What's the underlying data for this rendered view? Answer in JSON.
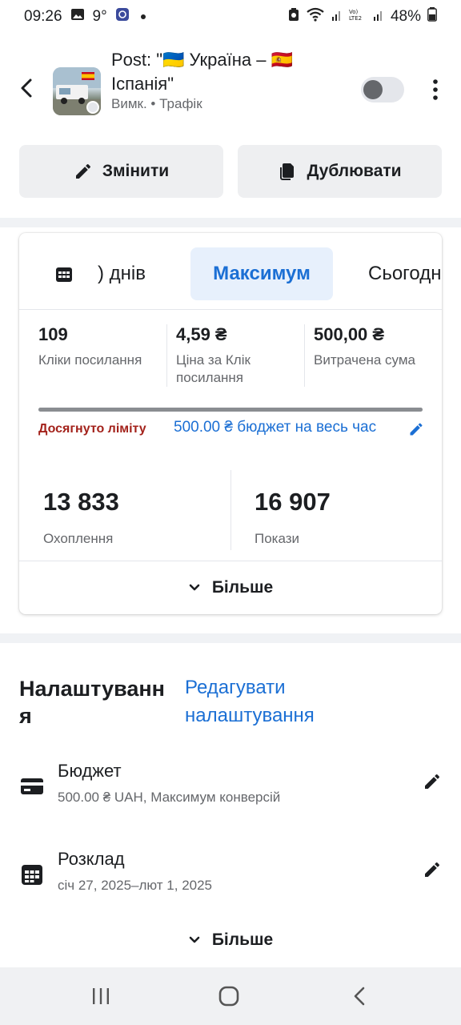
{
  "status_bar": {
    "time": "09:26",
    "temperature": "9°",
    "battery": "48%"
  },
  "header": {
    "title": "Post: \"🇺🇦 Україна – 🇪🇸 Іспанія\"",
    "status": "Вимк.",
    "separator": "•",
    "objective": "Трафік"
  },
  "actions": {
    "edit_label": "Змінити",
    "duplicate_label": "Дублювати"
  },
  "date_tabs": [
    {
      "label": ") днів"
    },
    {
      "label": "Максимум",
      "selected": true
    },
    {
      "label": "Сьогодні"
    }
  ],
  "metrics": [
    {
      "value": "109",
      "label": "Кліки посилання"
    },
    {
      "value": "4,59 ₴",
      "label": "Ціна за Клік посилання"
    },
    {
      "value": "500,00 ₴",
      "label": "Витрачена сума"
    }
  ],
  "budget_progress": {
    "fraction": 1.0,
    "limit_text": "Досягнуто ліміту",
    "budget_text": "500.00 ₴ бюджет на весь час"
  },
  "big_metrics": [
    {
      "value": "13 833",
      "label": "Охоплення"
    },
    {
      "value": "16 907",
      "label": "Покази"
    }
  ],
  "card_more_label": "Більше",
  "settings": {
    "title": "Налаштування",
    "edit_link": "Редагувати налаштування",
    "rows": [
      {
        "name": "Бюджет",
        "desc": "500.00 ₴ UAH, Максимум конверсій",
        "icon": "card-icon"
      },
      {
        "name": "Розклад",
        "desc": "січ 27, 2025–лют 1, 2025",
        "icon": "calendar-icon"
      }
    ],
    "more_label": "Більше"
  }
}
